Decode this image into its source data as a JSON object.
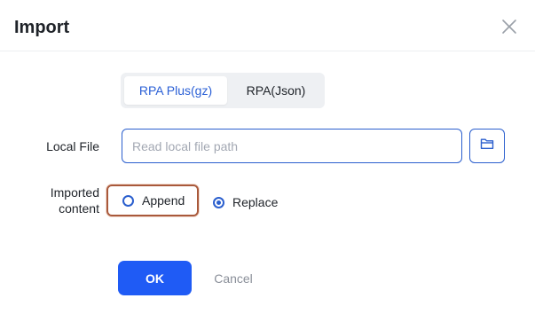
{
  "dialog": {
    "title": "Import"
  },
  "tabs": [
    {
      "label": "RPA Plus(gz)",
      "active": true
    },
    {
      "label": "RPA(Json)",
      "active": false
    }
  ],
  "form": {
    "local_file": {
      "label": "Local File",
      "value": "",
      "placeholder": "Read local file path"
    },
    "imported_content": {
      "label_line1": "Imported",
      "label_line2": "content",
      "options": [
        {
          "label": "Append",
          "selected": false
        },
        {
          "label": "Replace",
          "selected": true
        }
      ]
    }
  },
  "buttons": {
    "ok": "OK",
    "cancel": "Cancel"
  },
  "icons": {
    "close": "close-icon",
    "folder": "folder-icon"
  },
  "colors": {
    "accent": "#1f5bf5",
    "tab_active_text": "#2b60d6",
    "focus_outline": "#a9593b"
  }
}
